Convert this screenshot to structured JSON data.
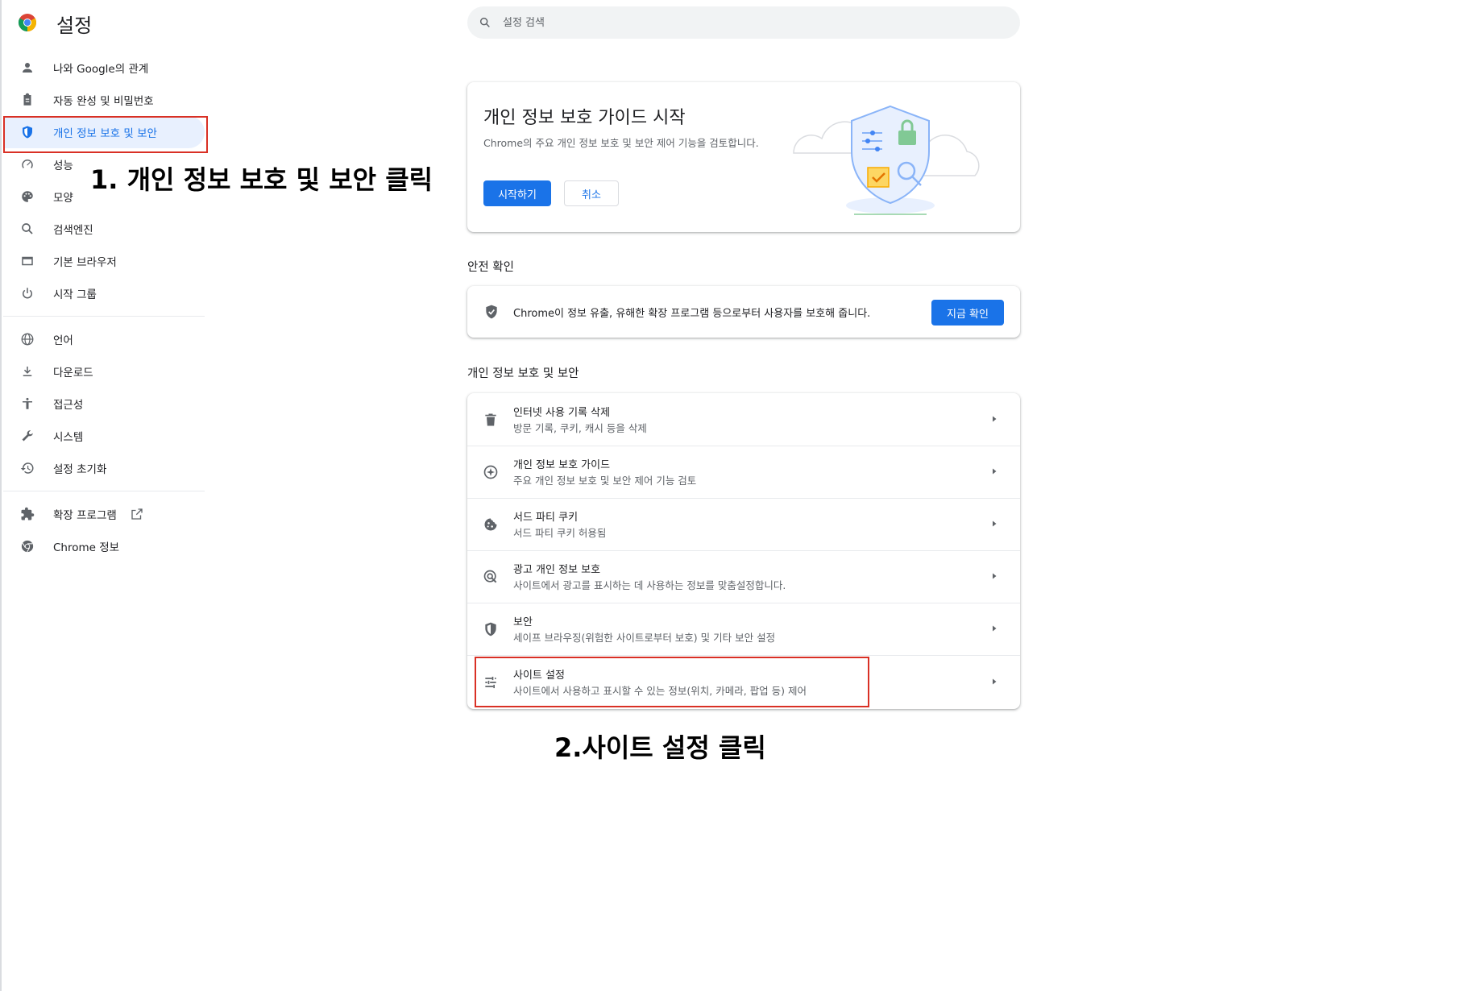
{
  "header": {
    "title": "설정",
    "search_placeholder": "설정 검색"
  },
  "sidebar": {
    "items": [
      {
        "label": "나와 Google의 관계",
        "icon": "person-icon"
      },
      {
        "label": "자동 완성 및 비밀번호",
        "icon": "clipboard-icon"
      },
      {
        "label": "개인 정보 보호 및 보안",
        "icon": "shield-icon",
        "active": true
      },
      {
        "label": "성능",
        "icon": "speedometer-icon"
      },
      {
        "label": "모양",
        "icon": "palette-icon"
      },
      {
        "label": "검색엔진",
        "icon": "search-icon"
      },
      {
        "label": "기본 브라우저",
        "icon": "browser-icon"
      },
      {
        "label": "시작 그룹",
        "icon": "power-icon"
      },
      {
        "label": "언어",
        "icon": "globe-icon"
      },
      {
        "label": "다운로드",
        "icon": "download-icon"
      },
      {
        "label": "접근성",
        "icon": "accessibility-icon"
      },
      {
        "label": "시스템",
        "icon": "wrench-icon"
      },
      {
        "label": "설정 초기화",
        "icon": "history-icon"
      },
      {
        "label": "확장 프로그램",
        "icon": "puzzle-icon"
      },
      {
        "label": "Chrome 정보",
        "icon": "chrome-icon"
      }
    ]
  },
  "annotations": {
    "step1": "1. 개인 정보 보호 및 보안 클릭",
    "step2": "2.사이트 설정 클릭"
  },
  "privacy_guide_promo": {
    "title": "개인 정보 보호 가이드 시작",
    "description": "Chrome의 주요 개인 정보 보호 및 보안 제어 기능을 검토합니다.",
    "start_button": "시작하기",
    "cancel_button": "취소"
  },
  "safety_check": {
    "heading": "안전 확인",
    "text": "Chrome이 정보 유출, 유해한 확장 프로그램 등으로부터 사용자를 보호해 줍니다.",
    "button": "지금 확인"
  },
  "privacy_section": {
    "heading": "개인 정보 보호 및 보안",
    "rows": [
      {
        "title": "인터넷 사용 기록 삭제",
        "subtitle": "방문 기록, 쿠키, 캐시 등을 삭제",
        "icon": "trash-icon"
      },
      {
        "title": "개인 정보 보호 가이드",
        "subtitle": "주요 개인 정보 보호 및 보안 제어 기능 검토",
        "icon": "compass-icon"
      },
      {
        "title": "서드 파티 쿠키",
        "subtitle": "서드 파티 쿠키 허용됨",
        "icon": "cookie-icon"
      },
      {
        "title": "광고 개인 정보 보호",
        "subtitle": "사이트에서 광고를 표시하는 데 사용하는 정보를 맞춤설정합니다.",
        "icon": "ad-privacy-icon"
      },
      {
        "title": "보안",
        "subtitle": "세이프 브라우징(위험한 사이트로부터 보호) 및 기타 보안 설정",
        "icon": "security-shield-icon"
      },
      {
        "title": "사이트 설정",
        "subtitle": "사이트에서 사용하고 표시할 수 있는 정보(위치, 카메라, 팝업 등) 제어",
        "icon": "sliders-icon"
      }
    ]
  },
  "colors": {
    "accent": "#1a73e8",
    "highlight": "#d93025",
    "active_bg": "#e8f0fe"
  }
}
